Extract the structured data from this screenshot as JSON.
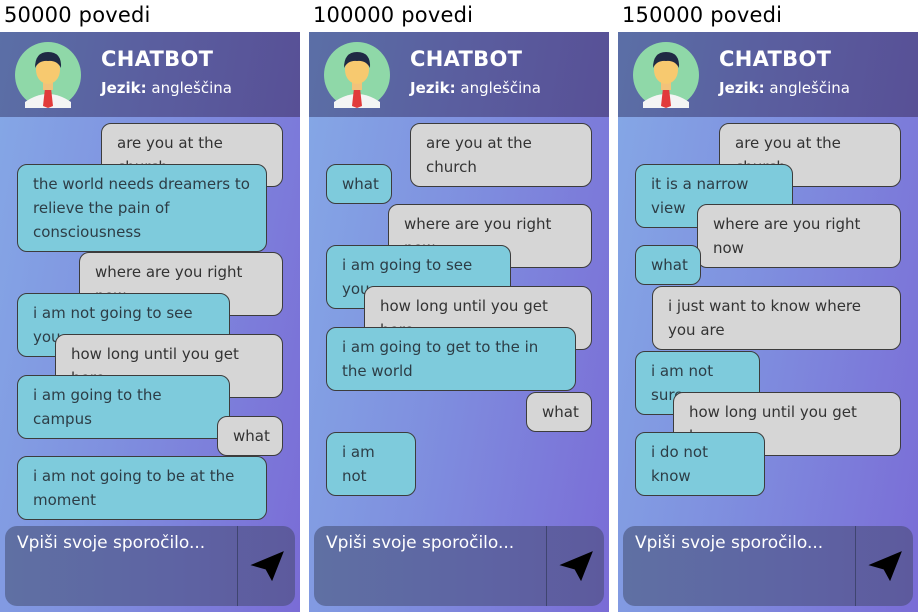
{
  "chatbot": {
    "title": "CHATBOT",
    "lang_label": "Jezik:",
    "lang_value": "angleščina"
  },
  "input": {
    "placeholder": "Vpiši svoje sporočilo..."
  },
  "panels": [
    {
      "caption": "50000 povedi",
      "messages": [
        {
          "from": "user",
          "text": "are you at the church"
        },
        {
          "from": "bot",
          "text": "the world needs dreamers to relieve the pain of consciousness"
        },
        {
          "from": "user",
          "text": "where are you right now"
        },
        {
          "from": "bot",
          "text": "i am not going to see you"
        },
        {
          "from": "user",
          "text": "how long until you get here"
        },
        {
          "from": "bot",
          "text": "i am going to the campus"
        },
        {
          "from": "user",
          "text": "what"
        },
        {
          "from": "bot",
          "text": "i am not going to be at the moment"
        }
      ]
    },
    {
      "caption": "100000 povedi",
      "messages": [
        {
          "from": "user",
          "text": "are you at the church"
        },
        {
          "from": "bot",
          "text": "what"
        },
        {
          "from": "user",
          "text": "where are you right now"
        },
        {
          "from": "bot",
          "text": "i am going to see you"
        },
        {
          "from": "user",
          "text": "how long until you get here"
        },
        {
          "from": "bot",
          "text": "i am going to get to the in the world"
        },
        {
          "from": "user",
          "text": "what"
        },
        {
          "from": "bot",
          "text": "i am not"
        }
      ]
    },
    {
      "caption": "150000 povedi",
      "messages": [
        {
          "from": "user",
          "text": "are you at the church"
        },
        {
          "from": "bot",
          "text": "it is a narrow view"
        },
        {
          "from": "user",
          "text": "where are you right now"
        },
        {
          "from": "bot",
          "text": "what"
        },
        {
          "from": "user",
          "text": "i just want to know where you are"
        },
        {
          "from": "bot",
          "text": "i am not sure"
        },
        {
          "from": "user",
          "text": "how long until you get here"
        },
        {
          "from": "bot",
          "text": "i do not know"
        }
      ]
    }
  ]
}
